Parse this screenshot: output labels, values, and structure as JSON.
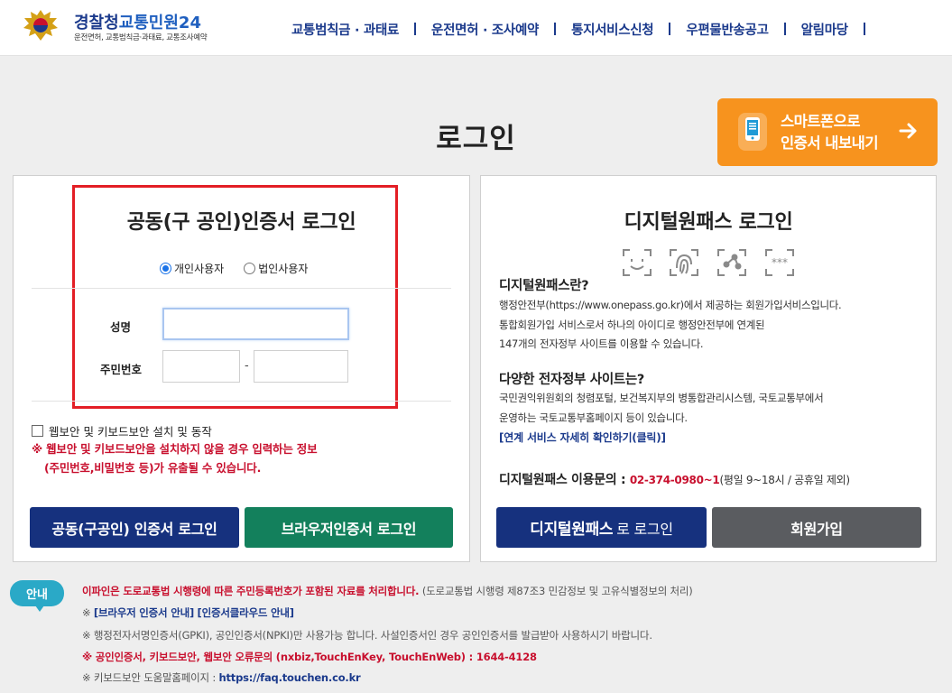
{
  "header": {
    "logo_title_a": "경찰청",
    "logo_title_b": "교통민원24",
    "logo_subtitle": "운전면허, 교통범칙금·과태료, 교통조사예약",
    "nav": [
      "교통범칙금 · 과태료",
      "운전면허 · 조사예약",
      "통지서비스신청",
      "우편물반송공고",
      "알림마당"
    ]
  },
  "page": {
    "title": "로그인"
  },
  "smart_export": {
    "line1": "스마트폰으로",
    "line2": "인증서 내보내기",
    "icon": "smartphone-icon",
    "arrow": "arrow-right-icon"
  },
  "cert_login": {
    "title": "공동(구 공인)인증서 로그인",
    "user_types": [
      "개인사용자",
      "법인사용자"
    ],
    "selected_user_type": "개인사용자",
    "name_label": "성명",
    "name_value": "",
    "rrn_label": "주민번호",
    "rrn_first": "",
    "rrn_dash": "-",
    "rrn_second": "",
    "security_checkbox_label": "웹보안 및 키보드보안 설치 및 동작",
    "security_checked": false,
    "warning_line1": "※ 웹보안 및 키보드보안을 설치하지 않을 경우 입력하는 정보",
    "warning_line2": "(주민번호,비밀번호 등)가 유출될 수 있습니다.",
    "btn_cert_login": "공동(구공인) 인증서 로그인",
    "btn_browser_login": "브라우저인증서 로그인"
  },
  "digital_onepass": {
    "title": "디지털원패스 로그인",
    "icons": [
      "face-recognition-icon",
      "fingerprint-icon",
      "pattern-icon",
      "pin-icon"
    ],
    "q1": "디지털원패스란?",
    "a1": [
      "행정안전부(https://www.onepass.go.kr)에서 제공하는 회원가입서비스입니다.",
      "통합회원가입 서비스로서 하나의 아이디로 행정안전부에 연계된",
      "147개의 전자정부 사이트를 이용할 수 있습니다."
    ],
    "q2": "다양한 전자정부 사이트는?",
    "a2": [
      "국민권익위원회의 청렴포털, 보건복지부의 병통합관리시스템, 국토교통부에서",
      "운영하는 국토교통부홈페이지 등이 있습니다."
    ],
    "link": "[연계 서비스 자세히 확인하기(클릭)]",
    "contact_label": "디지털원패스 이용문의 :",
    "contact_phone": "02-374-0980~1",
    "contact_hours": "(평일 9~18시 / 공휴일 제외)",
    "btn_login_a": "디지털원패스",
    "btn_login_b": "로 로그인",
    "btn_join": "회원가입"
  },
  "notice": {
    "badge": "안내",
    "line1_main": "이파인은 도로교통법 시행령에 따른 주민등록번호가 포함된 자료를 처리합니다.",
    "line1_sub": "(도로교통법 시행령 제87조3 민감정보 및 고유식별정보의 처리)",
    "line2_prefix": "※",
    "line2_link1": "[브라우저 인증서 안내]",
    "line2_link2": "[인증서클라우드 안내]",
    "line3": "※ 행정전자서명인증서(GPKI), 공인인증서(NPKI)만 사용가능 합니다. 사설인증서인 경우 공인인증서를 발급받아 사용하시기 바랍니다.",
    "line4": "※ 공인인증서, 키보드보안, 웹보안 오류문의 (nxbiz,TouchEnKey, TouchEnWeb) : 1644-4128",
    "line5_prefix": "※ 키보드보안 도움말홈페이지 :",
    "line5_url": "https://faq.touchen.co.kr"
  },
  "colors": {
    "navy": "#16317e",
    "green": "#13805c",
    "orange": "#f7931e",
    "red": "#c8102e",
    "teal": "#2aa9c7"
  }
}
